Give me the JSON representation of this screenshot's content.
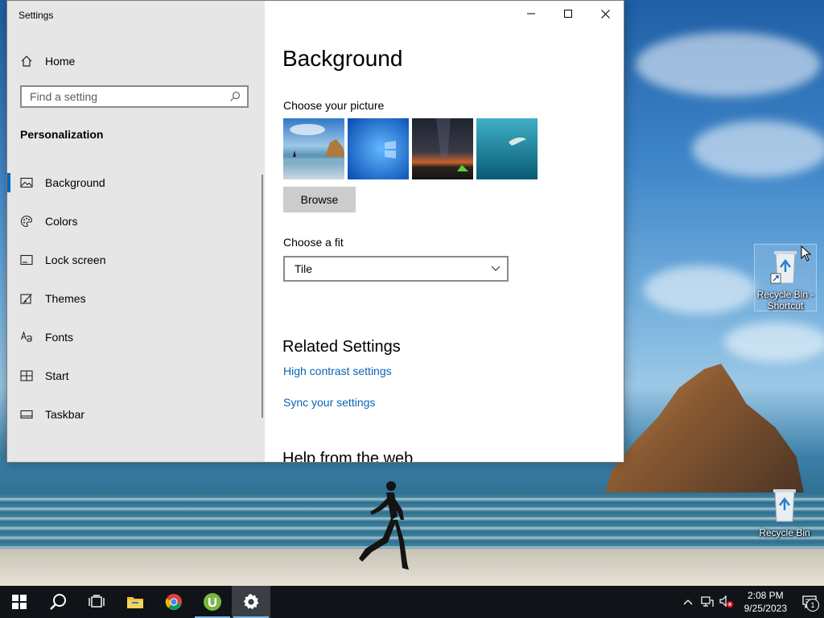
{
  "window": {
    "title": "Settings",
    "controls": {
      "minimize": "minimize",
      "maximize": "maximize",
      "close": "close"
    }
  },
  "sidebar": {
    "home_label": "Home",
    "search_placeholder": "Find a setting",
    "section_title": "Personalization",
    "items": [
      {
        "label": "Background",
        "icon": "picture-icon",
        "active": true
      },
      {
        "label": "Colors",
        "icon": "palette-icon"
      },
      {
        "label": "Lock screen",
        "icon": "lock-screen-icon"
      },
      {
        "label": "Themes",
        "icon": "themes-icon"
      },
      {
        "label": "Fonts",
        "icon": "fonts-icon"
      },
      {
        "label": "Start",
        "icon": "start-icon"
      },
      {
        "label": "Taskbar",
        "icon": "taskbar-icon"
      }
    ]
  },
  "main": {
    "title": "Background",
    "choose_picture_label": "Choose your picture",
    "pictures": [
      "beach-rock-picture",
      "windows-blue-picture",
      "night-sky-tent-picture",
      "underwater-swimmer-picture"
    ],
    "browse_label": "Browse",
    "choose_fit_label": "Choose a fit",
    "fit_value": "Tile",
    "related_title": "Related Settings",
    "links": [
      "High contrast settings",
      "Sync your settings"
    ],
    "help_title": "Help from the web"
  },
  "desktop": {
    "icons": [
      {
        "label": "Recycle Bin - Shortcut",
        "selected": true
      },
      {
        "label": "Recycle Bin",
        "selected": false
      }
    ]
  },
  "taskbar": {
    "apps": [
      "start-icon",
      "search-icon",
      "task-view-icon",
      "file-explorer-icon",
      "chrome-icon",
      "utorrent-icon",
      "settings-icon"
    ],
    "clock_time": "2:08 PM",
    "clock_date": "9/25/2023",
    "notification_count": "1"
  },
  "colors": {
    "accent": "#0067c0",
    "link": "#0a64b4",
    "sidebar_bg": "#e6e6e6",
    "taskbar_bg": "#101418"
  }
}
